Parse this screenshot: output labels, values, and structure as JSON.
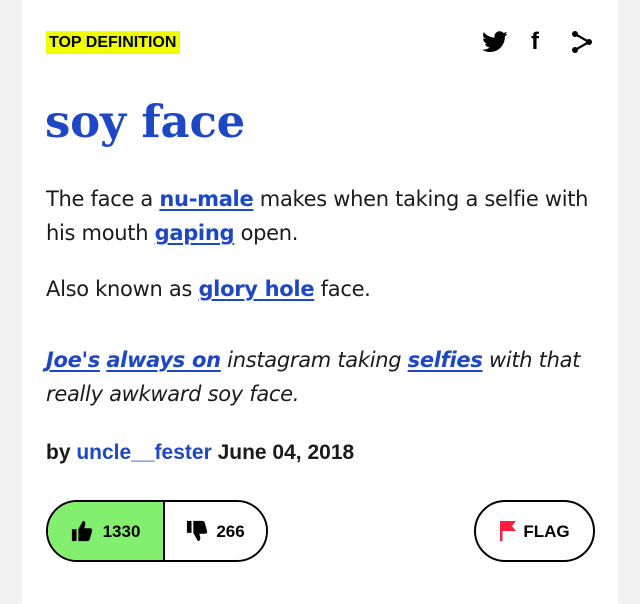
{
  "badge": "TOP DEFINITION",
  "share": {
    "twitter_icon": "twitter-icon",
    "facebook_label": "f",
    "other_icon": "share-icon"
  },
  "word": "soy face",
  "definition": {
    "p1_a": "The face a ",
    "p1_link1": "nu-male",
    "p1_b": " makes when taking a selfie with his mouth ",
    "p1_link2": "gaping",
    "p1_c": " open.",
    "p2_a": "Also known as ",
    "p2_link": "glory hole",
    "p2_b": " face."
  },
  "example": {
    "link1": "Joe's",
    "link2": "always on",
    "a": " instagram taking ",
    "link3": "selfies",
    "b": " with that really awkward soy face."
  },
  "contributor": {
    "by": "by ",
    "author": "uncle__fester",
    "date": " June 04, 2018"
  },
  "votes": {
    "up": "1330",
    "down": "266"
  },
  "flag": {
    "label": "FLAG",
    "color": "#ff1d3c"
  },
  "colors": {
    "accent": "#1d47c4",
    "upvote_bg": "#84ef6f",
    "badge_bg": "#efff00"
  }
}
